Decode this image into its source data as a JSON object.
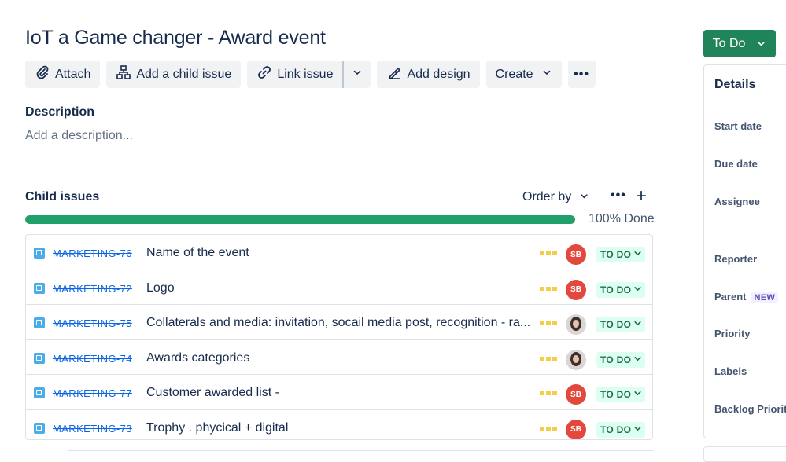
{
  "issue": {
    "title": "IoT a Game changer - Award event"
  },
  "toolbar": {
    "attach": "Attach",
    "add_child": "Add a child issue",
    "link_issue": "Link issue",
    "add_design": "Add design",
    "create": "Create"
  },
  "description": {
    "heading": "Description",
    "placeholder": "Add a description..."
  },
  "child_issues": {
    "heading": "Child issues",
    "order_by": "Order by",
    "progress_label": "100% Done",
    "progress_percent": 100,
    "rows": [
      {
        "key": "MARKETING-76",
        "summary": "Name of the event",
        "assignee": "SB",
        "status": "TO DO"
      },
      {
        "key": "MARKETING-72",
        "summary": "Logo",
        "assignee": "SB",
        "status": "TO DO"
      },
      {
        "key": "MARKETING-75",
        "summary": "Collaterals and media: invitation, socail media post, recognition - ra...",
        "assignee": "",
        "status": "TO DO"
      },
      {
        "key": "MARKETING-74",
        "summary": "Awards categories",
        "assignee": "",
        "status": "TO DO"
      },
      {
        "key": "MARKETING-77",
        "summary": "Customer awarded list -",
        "assignee": "SB",
        "status": "TO DO"
      },
      {
        "key": "MARKETING-73",
        "summary": "Trophy . phycical + digital",
        "assignee": "SB",
        "status": "TO DO"
      }
    ]
  },
  "status_button": {
    "label": "To Do"
  },
  "details": {
    "heading": "Details",
    "fields": {
      "start_date": "Start date",
      "due_date": "Due date",
      "assignee": "Assignee",
      "reporter": "Reporter",
      "parent": "Parent",
      "parent_badge": "NEW",
      "priority": "Priority",
      "labels": "Labels",
      "backlog_priority": "Backlog Priorit"
    }
  },
  "colors": {
    "status_green": "#1f845a",
    "progress_green": "#22a06b",
    "link_blue": "#0c66e4",
    "priority_medium": "#f5cd47",
    "avatar_red": "#e2483d"
  }
}
